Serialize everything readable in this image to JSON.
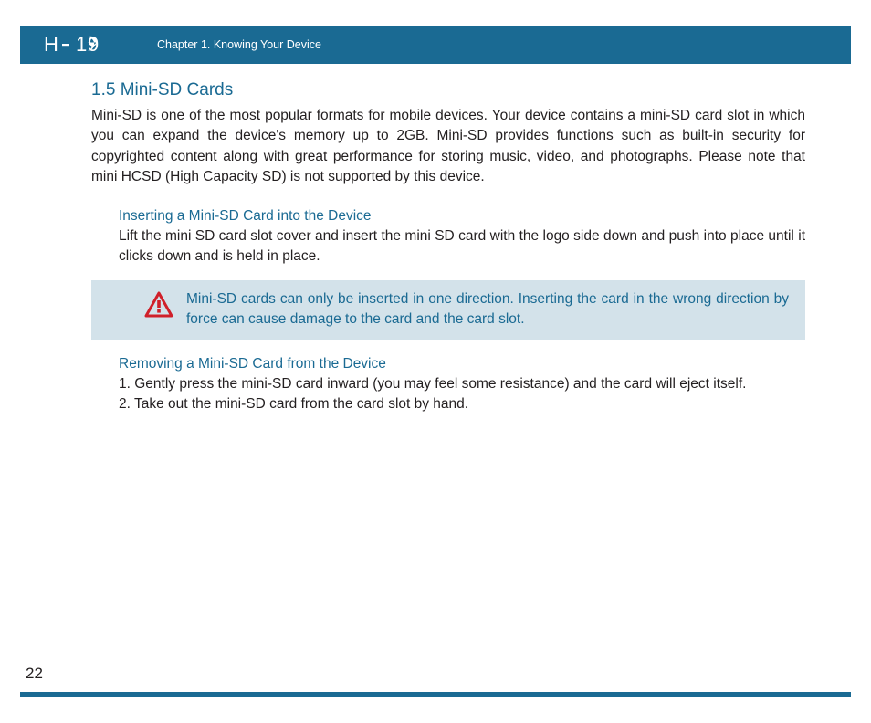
{
  "header": {
    "logo": "H-19",
    "chapter": "Chapter 1. Knowing Your Device"
  },
  "section": {
    "title": "1.5 Mini-SD Cards",
    "intro": "Mini-SD is one of the most popular formats for mobile devices. Your device contains a mini-SD card slot in which you can expand the device's memory up to 2GB. Mini-SD provides functions such as built-in security for copyrighted content along with great performance for storing music, video, and photographs. Please note that mini HCSD (High Capacity SD) is not supported by this device."
  },
  "inserting": {
    "title": "Inserting a Mini-SD Card into the Device",
    "text": "Lift the mini SD card slot cover and insert the mini SD card with the logo side down and push into place until it clicks down and is held in place."
  },
  "warning": {
    "text": "Mini-SD cards can only be inserted in one direction. Inserting the card in the wrong direction by force can cause damage to the card and the card slot."
  },
  "removing": {
    "title": "Removing a Mini-SD Card from the Device",
    "step1": "1. Gently press the mini-SD card inward (you may feel some resistance) and the card will eject itself.",
    "step2": "2. Take out the mini-SD card from the card slot by hand."
  },
  "page_number": "22"
}
